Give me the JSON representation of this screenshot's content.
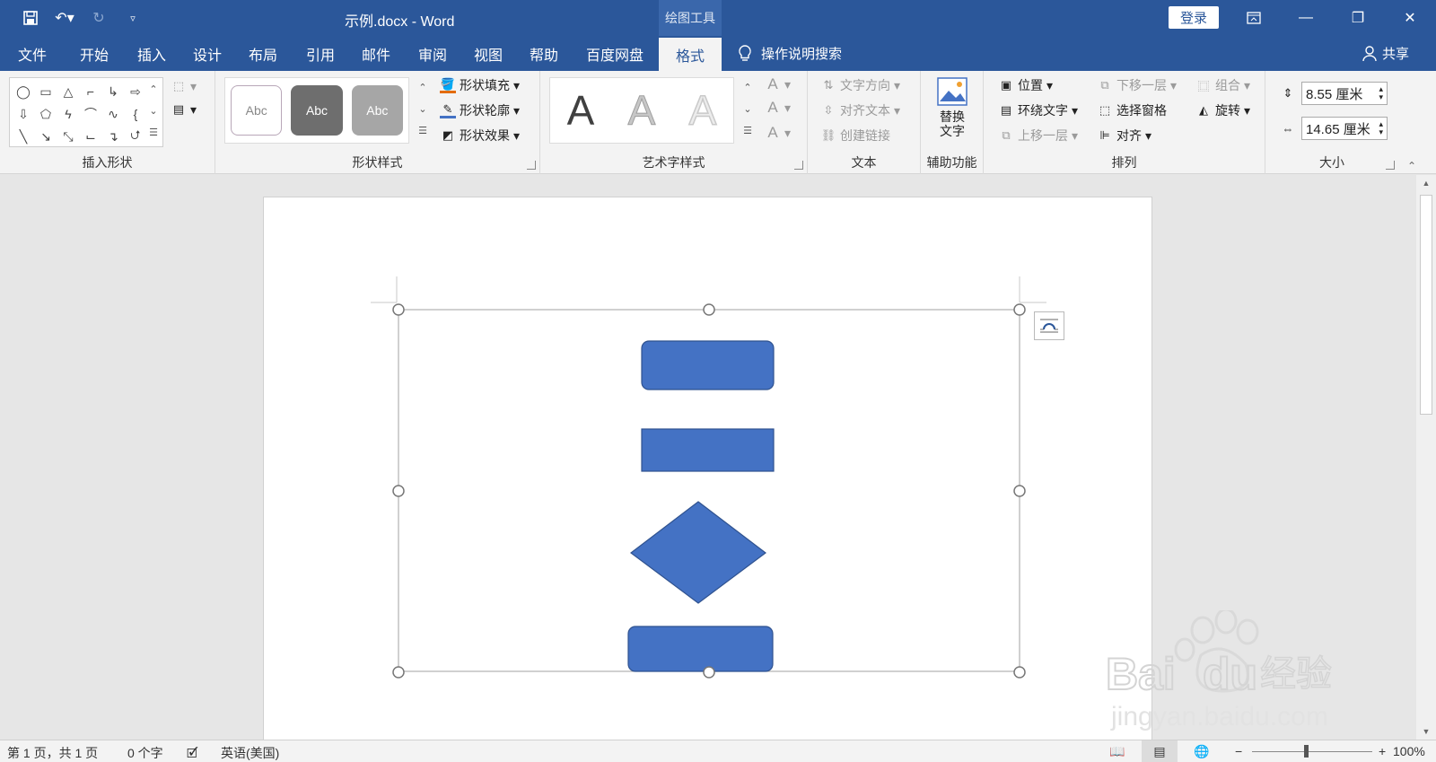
{
  "titlebar": {
    "doc_title": "示例.docx  -  Word",
    "context_tab_title": "绘图工具",
    "login_label": "登录"
  },
  "tabs": [
    "文件",
    "开始",
    "插入",
    "设计",
    "布局",
    "引用",
    "邮件",
    "审阅",
    "视图",
    "帮助",
    "百度网盘"
  ],
  "active_tab": "格式",
  "tell_me": "操作说明搜索",
  "share_label": "共享",
  "ribbon": {
    "insert_shapes": {
      "label": "插入形状"
    },
    "shape_styles": {
      "label": "形状样式",
      "sample_text": "Abc",
      "fill": "形状填充",
      "outline": "形状轮廓",
      "effect": "形状效果"
    },
    "wordart": {
      "label": "艺术字样式",
      "sample": "A"
    },
    "text": {
      "label": "文本",
      "direction": "文字方向",
      "align": "对齐文本",
      "link": "创建链接"
    },
    "accessibility": {
      "label": "辅助功能",
      "alt_text_line1": "替换",
      "alt_text_line2": "文字"
    },
    "arrange": {
      "label": "排列",
      "position": "位置",
      "wrap": "环绕文字",
      "forward": "上移一层",
      "backward": "下移一层",
      "selection_pane": "选择窗格",
      "align": "对齐",
      "group": "组合",
      "rotate": "旋转"
    },
    "size": {
      "label": "大小",
      "height": "8.55 厘米",
      "width": "14.65 厘米"
    }
  },
  "statusbar": {
    "page": "第 1 页，共 1 页",
    "words": "0 个字",
    "language": "英语(美国)",
    "zoom": "100%"
  },
  "colors": {
    "brand": "#2b579a",
    "shape_fill": "#4472c4",
    "shape_stroke": "#2f528f"
  }
}
